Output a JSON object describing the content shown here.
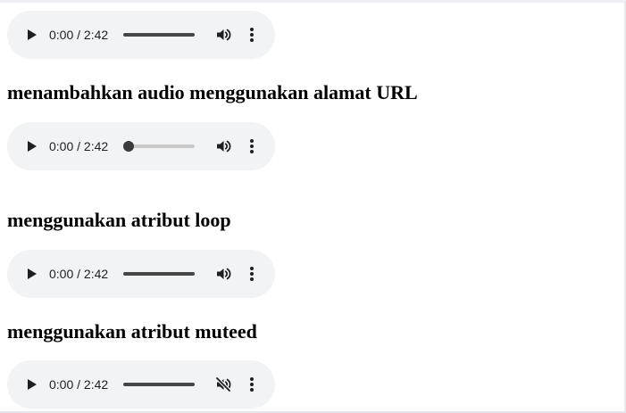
{
  "players": [
    {
      "time": "0:00 / 2:42",
      "progress": 0,
      "muted": false,
      "scrubber_active": false
    },
    {
      "time": "0:00 / 2:42",
      "progress": 0,
      "muted": false,
      "scrubber_active": true
    },
    {
      "time": "0:00 / 2:42",
      "progress": 0,
      "muted": false,
      "scrubber_active": false
    },
    {
      "time": "0:00 / 2:42",
      "progress": 0,
      "muted": true,
      "scrubber_active": false
    }
  ],
  "headings": {
    "url": "menambahkan audio menggunakan alamat URL",
    "loop": "menggunakan atribut loop",
    "muted": "menggunakan atribut muteed"
  },
  "icons": {
    "play": "play-icon",
    "volume": "volume-icon",
    "muted": "volume-muted-icon",
    "more": "more-options-icon"
  },
  "colors": {
    "player_bg": "#f1f3f4",
    "icon": "#1f1f1f",
    "rail_dark": "#474747",
    "rail_light": "#c9c9c9"
  }
}
